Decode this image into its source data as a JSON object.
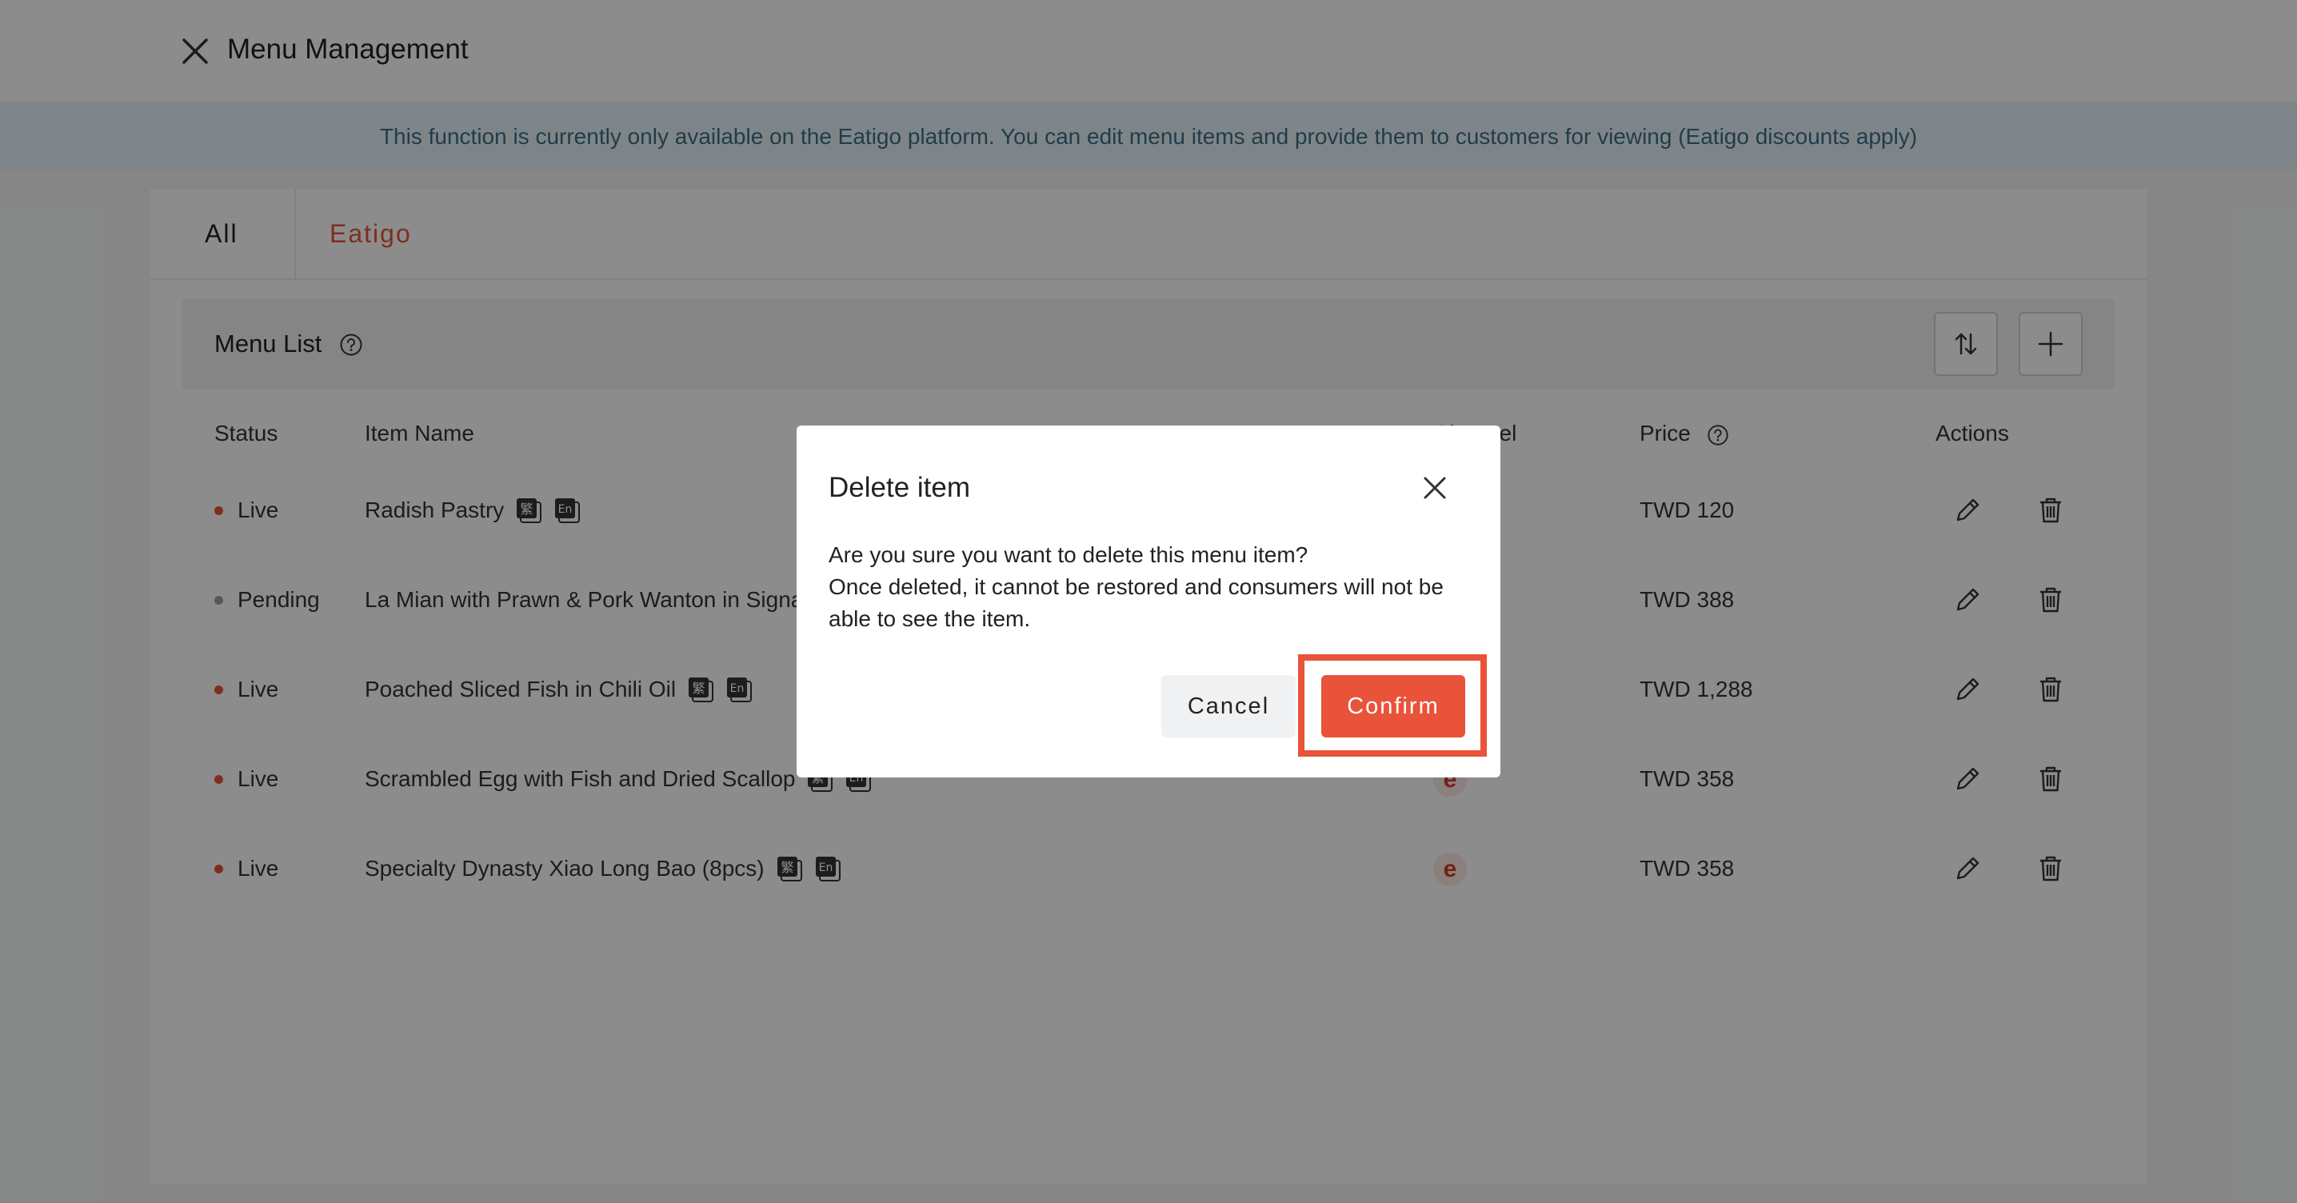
{
  "header": {
    "title": "Menu Management",
    "close_icon": "close-icon"
  },
  "banner": {
    "text": "This function is currently only available on the Eatigo platform. You can edit menu items and provide them to customers for viewing (Eatigo discounts apply)"
  },
  "tabs": [
    {
      "label": "All",
      "active": false
    },
    {
      "label": "Eatigo",
      "active": true
    }
  ],
  "menu_list": {
    "title": "Menu List",
    "help_icon": "help-icon",
    "sort_icon": "sort-icon",
    "add_icon": "plus-icon"
  },
  "table": {
    "columns": {
      "status": "Status",
      "item_name": "Item Name",
      "channel": "Channel",
      "price": "Price",
      "actions": "Actions"
    },
    "rows": [
      {
        "status": "Live",
        "status_color": "#e8533a",
        "name": "Radish Pastry",
        "price": "TWD 120"
      },
      {
        "status": "Pending",
        "status_color": "#9e9e9e",
        "name": "La Mian with Prawn & Pork Wanton in Signa",
        "price": "TWD 388"
      },
      {
        "status": "Live",
        "status_color": "#e8533a",
        "name": "Poached Sliced Fish in Chili Oil",
        "price": "TWD 1,288"
      },
      {
        "status": "Live",
        "status_color": "#e8533a",
        "name": "Scrambled Egg with Fish and Dried Scallop",
        "price": "TWD 358"
      },
      {
        "status": "Live",
        "status_color": "#e8533a",
        "name": "Specialty Dynasty Xiao Long Bao (8pcs)",
        "price": "TWD 358"
      }
    ],
    "channel_glyph": "e",
    "lang_icons": [
      "chinese-language-icon",
      "english-language-icon"
    ],
    "lang_zh": "繁",
    "lang_en": "En"
  },
  "modal": {
    "title": "Delete item",
    "line1": "Are you sure you want to delete this menu item?",
    "line2": "Once deleted, it cannot be restored and consumers will not be",
    "line3": "able to see the item.",
    "cancel_label": "Cancel",
    "confirm_label": "Confirm"
  },
  "colors": {
    "accent": "#e8533a",
    "banner_bg": "#e6f2f8",
    "banner_text": "#3d6e86"
  }
}
